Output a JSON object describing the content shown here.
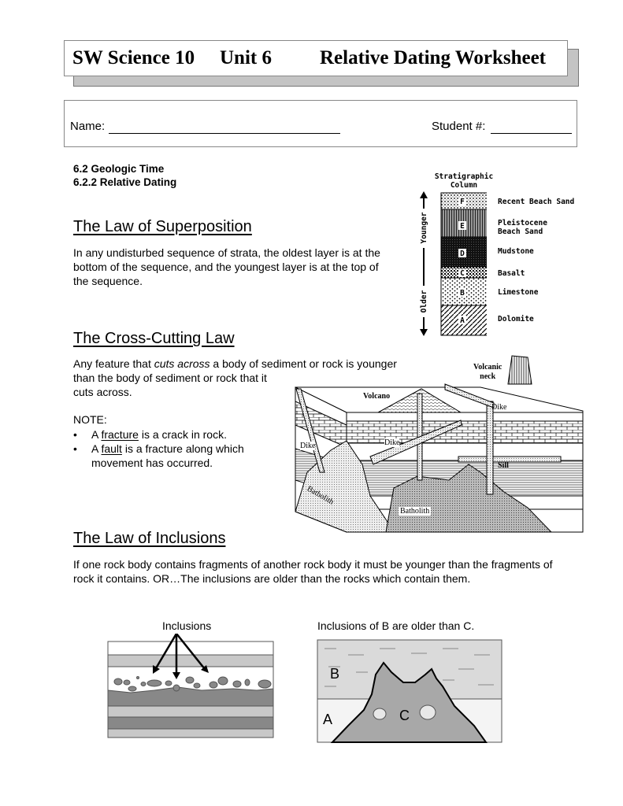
{
  "header": {
    "course": "SW Science 10",
    "unit": "Unit 6",
    "worksheet_title": "Relative Dating Worksheet"
  },
  "student_info": {
    "name_label": "Name:",
    "name_value": "",
    "student_number_label": "Student #:",
    "student_number_value": ""
  },
  "sections": {
    "section_number": "6.2  Geologic Time",
    "subsection_number": "6.2.2  Relative Dating"
  },
  "superposition": {
    "title": "The Law of Superposition",
    "text": "In any undisturbed sequence of strata, the oldest layer is at the bottom of the sequence, and the youngest layer is at the top of the sequence."
  },
  "strat_column": {
    "title_line1": "Stratigraphic",
    "title_line2": "Column",
    "axis_younger": "Younger",
    "axis_older": "Older",
    "layers": [
      {
        "letter": "F",
        "name": "Recent Beach Sand"
      },
      {
        "letter": "E",
        "name_line1": "Pleistocene",
        "name_line2": "Beach Sand"
      },
      {
        "letter": "D",
        "name": "Mudstone"
      },
      {
        "letter": "C",
        "name": "Basalt"
      },
      {
        "letter": "B",
        "name": "Limestone"
      },
      {
        "letter": "A",
        "name": "Dolomite"
      }
    ]
  },
  "cross_cutting": {
    "title": "The Cross-Cutting Law",
    "text_pre": "Any feature that ",
    "text_em": "cuts across",
    "text_post_line1": " a body of sediment or rock is younger",
    "text_line2": "than the body of sediment or rock that it",
    "text_line3": "cuts across.",
    "note_label": "NOTE:",
    "notes": [
      {
        "pre": "A ",
        "term": "fracture",
        "post": " is a crack in rock."
      },
      {
        "pre": "A ",
        "term": "fault",
        "post": " is a fracture along which movement has occurred."
      }
    ]
  },
  "block_diagram": {
    "labels": {
      "volcanic_neck_1": "Volcanic",
      "volcanic_neck_2": "neck",
      "volcano": "Volcano",
      "dike_right": "Dike",
      "dike_middle": "Dike",
      "dike_left": "Dike",
      "sill": "Sill",
      "batholith_left": "Batholith",
      "batholith_right": "Batholith"
    }
  },
  "inclusions": {
    "title": "The Law of Inclusions",
    "text": "If one rock body contains fragments of another rock body it must be younger than the fragments of rock it contains. OR…The inclusions are older than the rocks which contain them.",
    "figure1_caption": "Inclusions",
    "figure2_caption": "Inclusions of B are older than C.",
    "figure2_labels": {
      "a": "A",
      "b": "B",
      "c": "C"
    }
  }
}
